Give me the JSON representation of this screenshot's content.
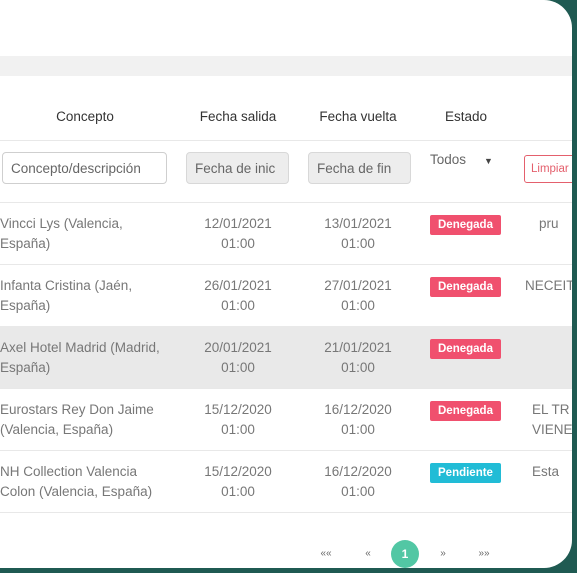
{
  "table": {
    "headers": {
      "concepto": "Concepto",
      "fecha_salida": "Fecha salida",
      "fecha_vuelta": "Fecha vuelta",
      "estado": "Estado"
    },
    "filters": {
      "concepto_placeholder": "Concepto/descripción",
      "fecha_inicio_placeholder": "Fecha de inic",
      "fecha_fin_placeholder": "Fecha de fin",
      "estado_selected": "Todos",
      "clear_label": "Limpiar"
    },
    "rows": [
      {
        "concepto": "Vincci Lys (Valencia, España)",
        "salida_fecha": "12/01/2021",
        "salida_hora": "01:00",
        "vuelta_fecha": "13/01/2021",
        "vuelta_hora": "01:00",
        "estado": "Denegada",
        "obs1": "pru",
        "obs2": ""
      },
      {
        "concepto": "Infanta Cristina (Jaén, España)",
        "salida_fecha": "26/01/2021",
        "salida_hora": "01:00",
        "vuelta_fecha": "27/01/2021",
        "vuelta_hora": "01:00",
        "estado": "Denegada",
        "obs1": "NECEIT",
        "obs2": ""
      },
      {
        "concepto": "Axel Hotel Madrid (Madrid, España)",
        "salida_fecha": "20/01/2021",
        "salida_hora": "01:00",
        "vuelta_fecha": "21/01/2021",
        "vuelta_hora": "01:00",
        "estado": "Denegada",
        "obs1": "",
        "obs2": ""
      },
      {
        "concepto": "Eurostars Rey Don Jaime (Valencia, España)",
        "salida_fecha": "15/12/2020",
        "salida_hora": "01:00",
        "vuelta_fecha": "16/12/2020",
        "vuelta_hora": "01:00",
        "estado": "Denegada",
        "obs1": "EL TR",
        "obs2": "VIENE N"
      },
      {
        "concepto": "NH Collection Valencia Colon (Valencia, España)",
        "salida_fecha": "15/12/2020",
        "salida_hora": "01:00",
        "vuelta_fecha": "16/12/2020",
        "vuelta_hora": "01:00",
        "estado": "Pendiente",
        "obs1": "Esta",
        "obs2": ""
      }
    ]
  },
  "status_colors": {
    "Denegada": "#f0506e",
    "Pendiente": "#21bcd6"
  },
  "pagination": {
    "first": "««",
    "prev": "«",
    "current": "1",
    "next": "»",
    "last": "»»"
  }
}
